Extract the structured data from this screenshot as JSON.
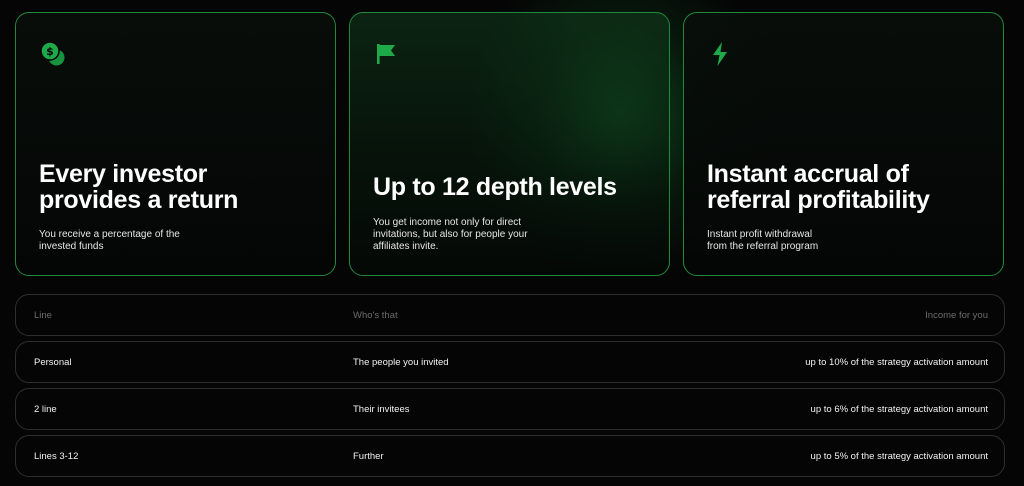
{
  "cards": [
    {
      "icon": "dollar-coins-icon",
      "title": "Every investor\nprovides a return",
      "description": "You receive a percentage of the\ninvested funds"
    },
    {
      "icon": "flag-icon",
      "title": "Up to 12 depth levels",
      "description": "You get income not only for direct\ninvitations, but also for people your\naffiliates invite."
    },
    {
      "icon": "lightning-icon",
      "title": "Instant accrual of\nreferral profitability",
      "description": "Instant profit withdrawal\nfrom the referral program"
    }
  ],
  "table": {
    "headers": {
      "line": "Line",
      "who": "Who's that",
      "income": "Income for you"
    },
    "rows": [
      {
        "line": "Personal",
        "who": "The people you invited",
        "income": "up to 10% of the strategy activation amount"
      },
      {
        "line": "2 line",
        "who": "Their invitees",
        "income": "up to 6% of the strategy activation amount"
      },
      {
        "line": "Lines 3-12",
        "who": "Further",
        "income": "up to 5% of the strategy activation amount"
      }
    ]
  },
  "colors": {
    "accent": "#1faa4a",
    "card_border": "#1f8a3b",
    "row_border": "#2e2e2e",
    "background": "#050505"
  }
}
